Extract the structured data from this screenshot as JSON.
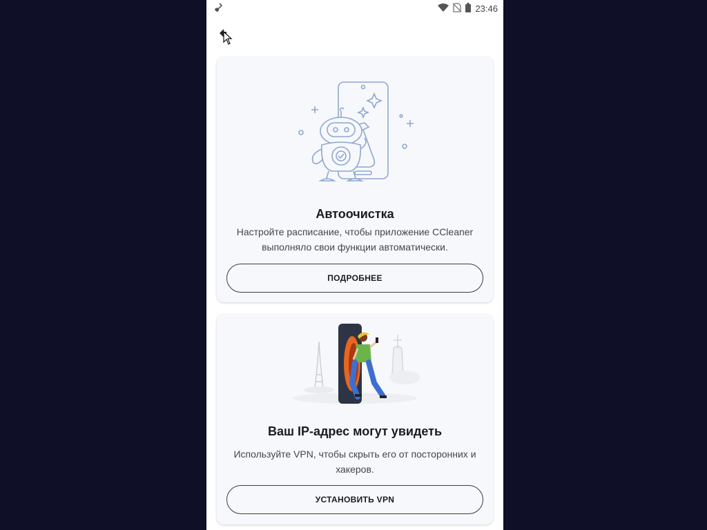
{
  "status_bar": {
    "time": "23:46",
    "icons": [
      "ccleaner-broom-icon",
      "wifi-icon",
      "no-sim-icon",
      "battery-icon"
    ]
  },
  "header": {
    "back_icon": "arrow-left-icon"
  },
  "cards": [
    {
      "illustration": "robot-cleaning-phone",
      "title": "Автоочистка",
      "description": "Настройте расписание, чтобы приложение CCleaner выполняло свои функции автоматически.",
      "button_label": "ПОДРОБНЕЕ"
    },
    {
      "illustration": "person-stepping-out-of-phone-vpn",
      "title": "Ваш IP-адрес могут увидеть",
      "description": "Используйте VPN, чтобы скрыть его от посторонних и хакеров.",
      "button_label": "УСТАНОВИТЬ VPN"
    }
  ],
  "colors": {
    "background": "#0f1027",
    "card": "#f6f8fb",
    "illustration_line": "#8fa6cf",
    "vpn_orange": "#e8661f"
  }
}
